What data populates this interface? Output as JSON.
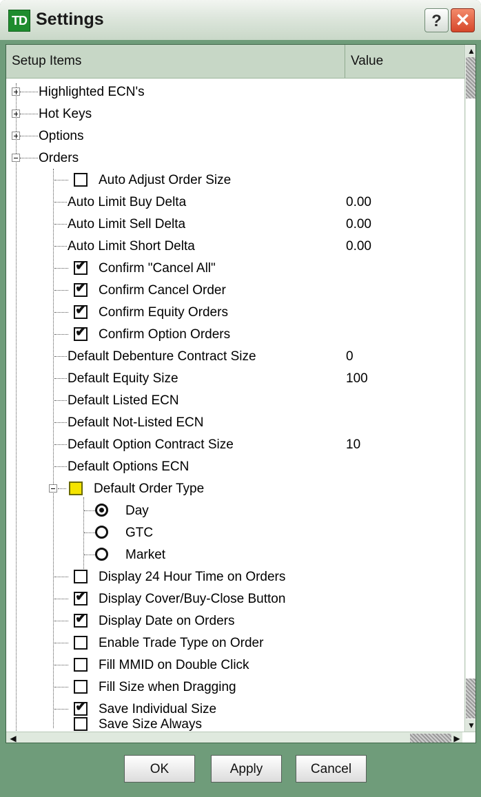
{
  "window": {
    "title": "Settings",
    "logo_text": "TD",
    "help_glyph": "?",
    "close_glyph": "✕"
  },
  "columns": {
    "setup_items": "Setup Items",
    "value": "Value"
  },
  "tree": {
    "groups": [
      {
        "label": "Highlighted ECN's",
        "expander": "+"
      },
      {
        "label": "Hot Keys",
        "expander": "+"
      },
      {
        "label": "Options",
        "expander": "+"
      },
      {
        "label": "Orders",
        "expander": "−"
      }
    ],
    "orders": [
      {
        "label": "Auto Adjust Order Size",
        "type": "checkbox",
        "checked": false,
        "value": ""
      },
      {
        "label": "Auto Limit Buy Delta",
        "type": "text",
        "value": "0.00"
      },
      {
        "label": "Auto Limit Sell Delta",
        "type": "text",
        "value": "0.00"
      },
      {
        "label": "Auto Limit Short Delta",
        "type": "text",
        "value": "0.00"
      },
      {
        "label": "Confirm \"Cancel All\"",
        "type": "checkbox",
        "checked": true,
        "value": ""
      },
      {
        "label": "Confirm Cancel Order",
        "type": "checkbox",
        "checked": true,
        "value": ""
      },
      {
        "label": "Confirm Equity Orders",
        "type": "checkbox",
        "checked": true,
        "value": ""
      },
      {
        "label": "Confirm Option Orders",
        "type": "checkbox",
        "checked": true,
        "value": ""
      },
      {
        "label": "Default Debenture Contract Size",
        "type": "text",
        "value": "0"
      },
      {
        "label": "Default Equity Size",
        "type": "text",
        "value": "100"
      },
      {
        "label": "Default Listed ECN",
        "type": "text",
        "value": ""
      },
      {
        "label": "Default Not-Listed ECN",
        "type": "text",
        "value": ""
      },
      {
        "label": "Default Option Contract Size",
        "type": "text",
        "value": "10"
      },
      {
        "label": "Default Options ECN",
        "type": "text",
        "value": ""
      }
    ],
    "order_type": {
      "label": "Default Order Type",
      "expander": "−",
      "options": [
        {
          "label": "Day",
          "selected": true
        },
        {
          "label": "GTC",
          "selected": false
        },
        {
          "label": "Market",
          "selected": false
        }
      ]
    },
    "orders_more": [
      {
        "label": "Display 24 Hour Time on Orders",
        "checked": false
      },
      {
        "label": "Display Cover/Buy-Close Button",
        "checked": true
      },
      {
        "label": "Display Date on Orders",
        "checked": true
      },
      {
        "label": "Enable Trade Type on Order",
        "checked": false
      },
      {
        "label": "Fill MMID on Double Click",
        "checked": false
      },
      {
        "label": "Fill Size when Dragging",
        "checked": false
      },
      {
        "label": "Save Individual Size",
        "checked": true
      },
      {
        "label": "Save Size Always",
        "checked": false
      }
    ]
  },
  "buttons": {
    "ok": "OK",
    "apply": "Apply",
    "cancel": "Cancel"
  },
  "icons": {
    "check": "✔",
    "scroll_up": "▲",
    "scroll_down": "▼",
    "scroll_left": "◀",
    "scroll_right": "▶"
  },
  "colors": {
    "frame": "#6f9c7a",
    "header_bg": "#c7d7c6",
    "default_order_type_box": "#f5e400"
  }
}
